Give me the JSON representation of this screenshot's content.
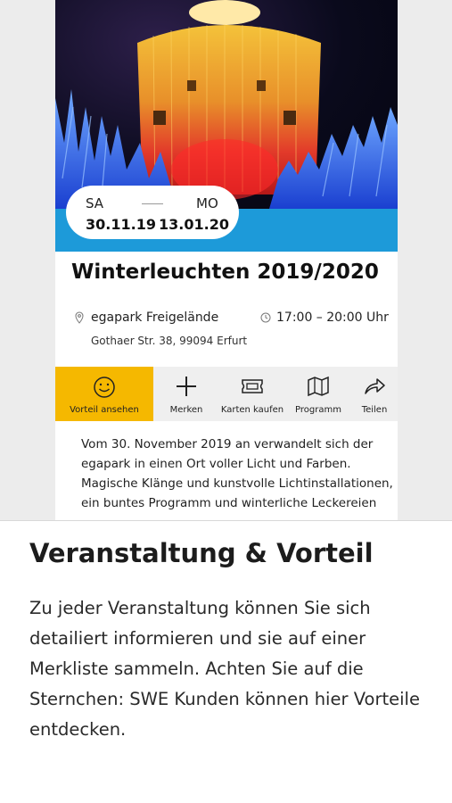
{
  "event": {
    "date_from_day": "SA",
    "date_to_day": "MO",
    "date_from": "30.11.19",
    "date_to": "13.01.20",
    "title": "Winterleuchten 2019/2020",
    "location": "egapark Freigelände",
    "time": "17:00 – 20:00 Uhr",
    "address": "Gothaer Str. 38, 99094 Erfurt"
  },
  "toolbar": {
    "items": [
      {
        "label": "Vorteil ansehen",
        "icon": "smiley-icon"
      },
      {
        "label": "Merken",
        "icon": "plus-icon"
      },
      {
        "label": "Karten kaufen",
        "icon": "ticket-icon"
      },
      {
        "label": "Programm",
        "icon": "map-icon"
      },
      {
        "label": "Teilen",
        "icon": "share-icon"
      }
    ],
    "active_color": "#f5b800"
  },
  "description": {
    "lines": [
      "Vom 30. November 2019 an verwandelt sich der",
      "egapark in einen Ort voller Licht und Farben.",
      "Magische Klänge und kunstvolle Lichtinstallationen,",
      "ein buntes Programm und winterliche Leckereien"
    ]
  },
  "onboarding": {
    "heading": "Veranstaltung & Vorteil",
    "lines": [
      "Zu jeder Veranstaltung können Sie sich",
      "detailiert informieren und sie auf einer",
      "Merkliste sammeln. Achten Sie auf die",
      "Sternchen: SWE Kunden können hier Vorteile",
      "entdecken."
    ]
  },
  "colors": {
    "accent_blue": "#1d9ad9",
    "accent_yellow": "#f5b800"
  }
}
